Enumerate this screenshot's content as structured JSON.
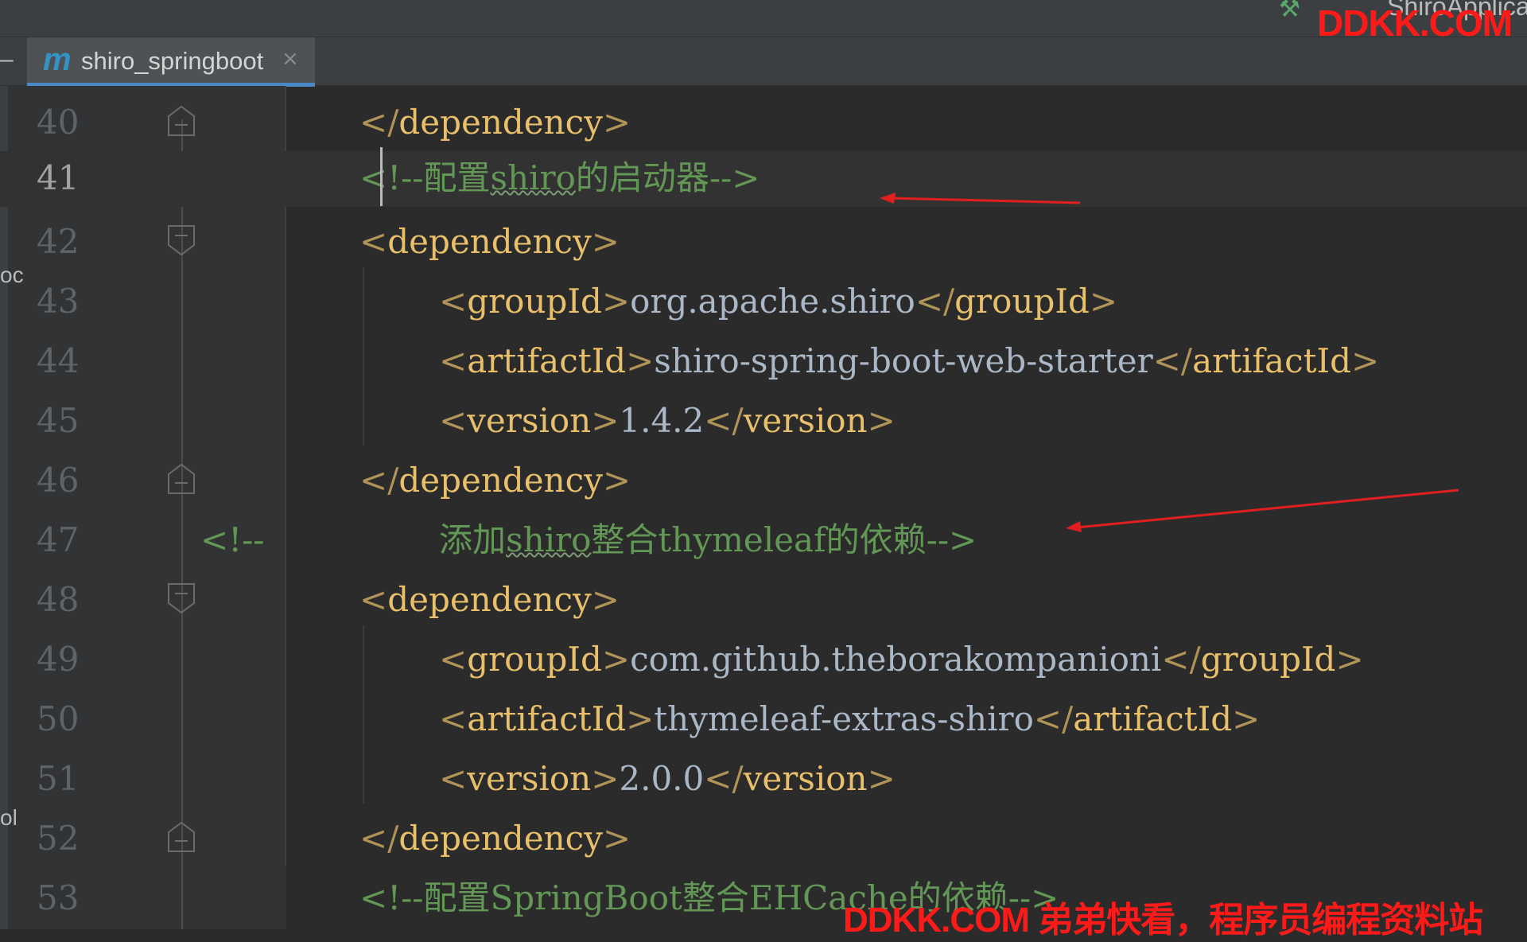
{
  "window": {
    "run_config_label": "ShiroApplica",
    "watermark_top": "DDKK.COM",
    "watermark_bottom": "DDKK.COM 弟弟快看，程序员编程资料站"
  },
  "tab": {
    "icon_letter": "m",
    "label": "shiro_springboot",
    "close_glyph": "×"
  },
  "left_panel_fragments": [
    "oc",
    "ol"
  ],
  "colors": {
    "tag": "#e8bf6a",
    "comment": "#629755",
    "text": "#a9b7c6",
    "line_number": "#606366",
    "annotation_arrow": "#e02020",
    "watermark": "#ff1a1a"
  },
  "editor": {
    "caret_line": 41,
    "lines": [
      {
        "n": "40",
        "open": "</",
        "name": "dependency",
        "close": ">"
      },
      {
        "n": "41",
        "comment_pre": "<!--配置",
        "comment_word": "shiro",
        "comment_post": "的启动器-->"
      },
      {
        "n": "42",
        "open": "<",
        "name": "dependency",
        "close": ">"
      },
      {
        "n": "43",
        "tag_a": "groupId",
        "value": "org.apache.shiro",
        "tag_b": "groupId"
      },
      {
        "n": "44",
        "tag_a": "artifactId",
        "value": "shiro-spring-boot-web-starter",
        "tag_b": "artifactId"
      },
      {
        "n": "45",
        "tag_a": "version",
        "value": "1.4.2",
        "tag_b": "version"
      },
      {
        "n": "46",
        "open": "</",
        "name": "dependency",
        "close": ">"
      },
      {
        "n": "47",
        "gutter_comment": "<!--",
        "comment_pre": "添加",
        "comment_word": "shiro",
        "comment_post": "整合thymeleaf的依赖-->"
      },
      {
        "n": "48",
        "open": "<",
        "name": "dependency",
        "close": ">"
      },
      {
        "n": "49",
        "tag_a": "groupId",
        "value": "com.github.theborakompanioni",
        "tag_b": "groupId"
      },
      {
        "n": "50",
        "tag_a": "artifactId",
        "value": "thymeleaf-extras-shiro",
        "tag_b": "artifactId"
      },
      {
        "n": "51",
        "tag_a": "version",
        "value": "2.0.0",
        "tag_b": "version"
      },
      {
        "n": "52",
        "open": "</",
        "name": "dependency",
        "close": ">"
      },
      {
        "n": "53",
        "comment_full": "<!--配置SpringBoot整合EHCache的依赖-->"
      }
    ]
  }
}
